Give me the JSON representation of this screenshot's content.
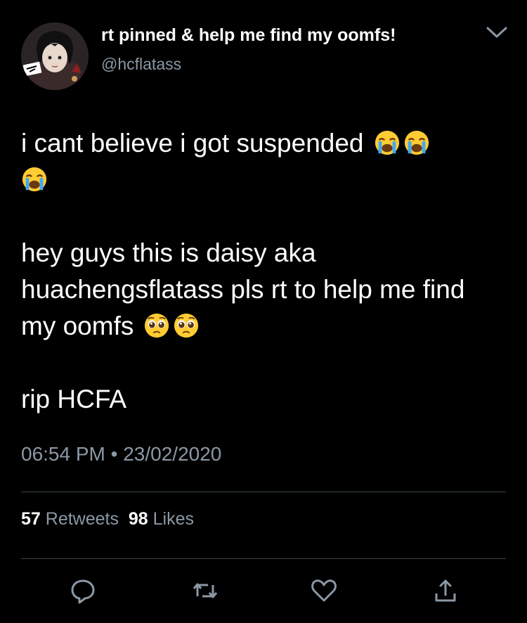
{
  "user": {
    "display_name": "rt pinned & help me find my oomfs!",
    "handle": "@hcflatass"
  },
  "tweet": {
    "line1": "i cant believe i got suspended",
    "line1_emoji": [
      "loudly-crying-face",
      "loudly-crying-face",
      "loudly-crying-face"
    ],
    "line2": "hey guys this is daisy aka huachengsflatass pls rt to help me find my oomfs",
    "line2_emoji": [
      "pleading-face",
      "pleading-face"
    ],
    "line3": "rip HCFA"
  },
  "meta": {
    "time": "06:54 PM",
    "separator": "•",
    "date": "23/02/2020"
  },
  "stats": {
    "retweets_count": "57",
    "retweets_label": "Retweets",
    "likes_count": "98",
    "likes_label": "Likes"
  },
  "actions": [
    "reply-icon",
    "retweet-icon",
    "like-icon",
    "share-icon"
  ],
  "colors": {
    "background": "#000000",
    "text": "#ffffff",
    "secondary": "#8b98a5",
    "divider": "#38444d"
  }
}
